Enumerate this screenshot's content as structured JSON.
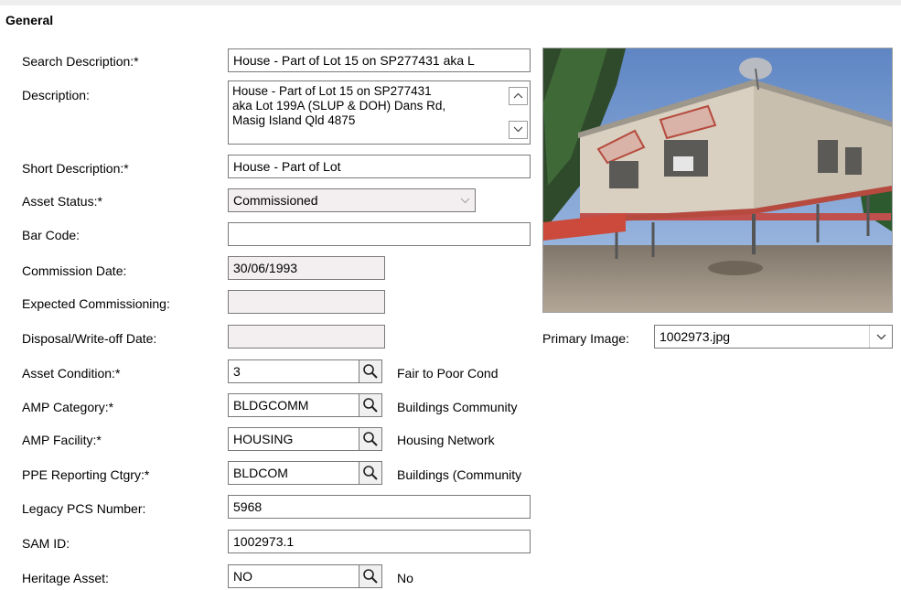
{
  "section_title": "General",
  "fields": {
    "search_description": {
      "label": "Search Description:*",
      "value": "House - Part of Lot 15 on SP277431 aka L"
    },
    "description": {
      "label": "Description:",
      "value": "House - Part of Lot 15 on SP277431\naka Lot 199A (SLUP & DOH) Dans Rd,\nMasig Island Qld 4875"
    },
    "short_description": {
      "label": "Short Description:*",
      "value": "House - Part of Lot"
    },
    "asset_status": {
      "label": "Asset Status:*",
      "value": "Commissioned"
    },
    "bar_code": {
      "label": "Bar Code:",
      "value": ""
    },
    "commission_date": {
      "label": "Commission Date:",
      "value": "30/06/1993"
    },
    "expected_commissioning": {
      "label": "Expected Commissioning:",
      "value": ""
    },
    "disposal_date": {
      "label": "Disposal/Write-off Date:",
      "value": ""
    },
    "asset_condition": {
      "label": "Asset Condition:*",
      "value": "3",
      "description": "Fair to Poor Cond"
    },
    "amp_category": {
      "label": "AMP Category:*",
      "value": "BLDGCOMM",
      "description": "Buildings Community"
    },
    "amp_facility": {
      "label": "AMP Facility:*",
      "value": "HOUSING",
      "description": "Housing Network"
    },
    "ppe_reporting": {
      "label": "PPE Reporting Ctgry:*",
      "value": "BLDCOM",
      "description": "Buildings (Community"
    },
    "legacy_pcs": {
      "label": "Legacy PCS Number:",
      "value": "5968"
    },
    "sam_id": {
      "label": "SAM ID:",
      "value": "1002973.1"
    },
    "heritage_asset": {
      "label": "Heritage Asset:",
      "value": "NO",
      "description": "No"
    }
  },
  "primary_image": {
    "label": "Primary Image:",
    "value": "1002973.jpg"
  },
  "icons": {
    "lookup": "magnifier-icon",
    "dropdown": "chevron-down-icon",
    "scroll_up": "chevron-up-icon",
    "scroll_down": "chevron-down-icon"
  },
  "colors": {
    "readonly_field_bg": "#f3eef0",
    "field_border": "#7a7a7a"
  }
}
